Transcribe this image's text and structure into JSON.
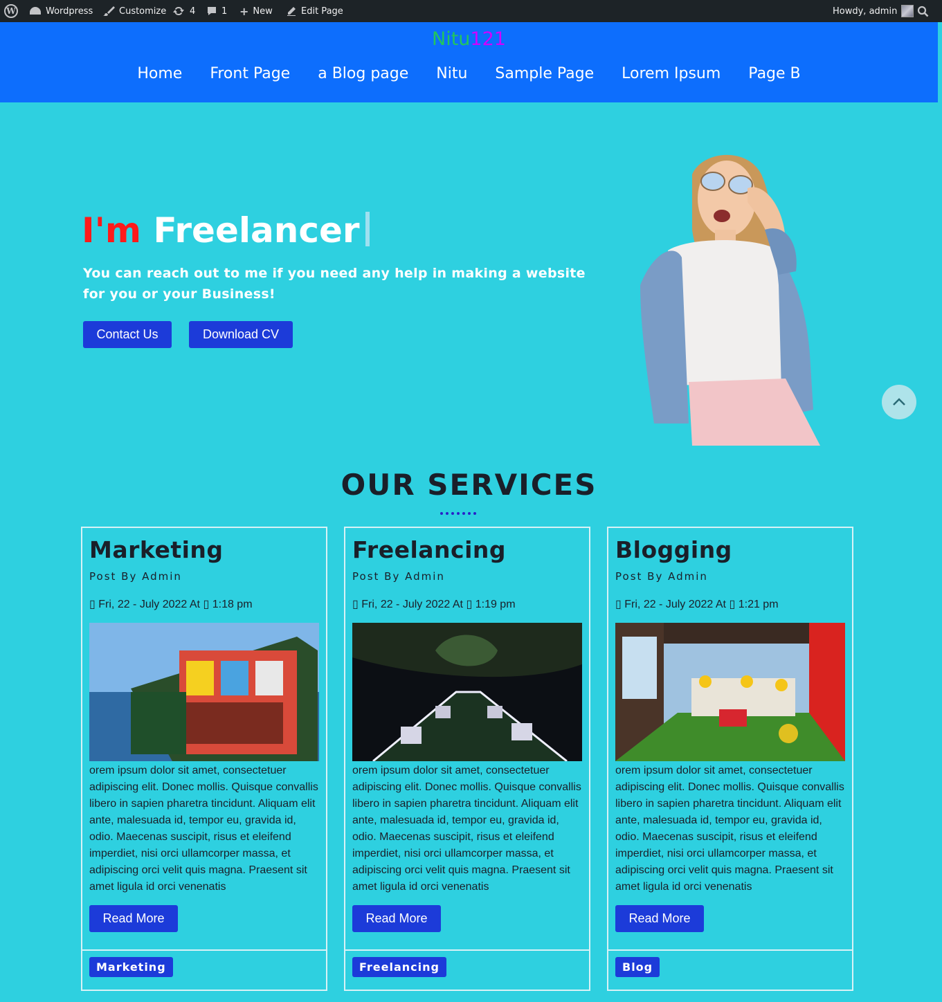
{
  "adminbar": {
    "site_name": "Wordpress",
    "customize": "Customize",
    "updates_count": "4",
    "comments_count": "1",
    "new": "New",
    "edit_page": "Edit Page",
    "howdy": "Howdy, admin"
  },
  "header": {
    "site_title_part1": "Nitu",
    "site_title_part2": "121",
    "nav": [
      "Home",
      "Front Page",
      "a Blog page",
      "Nitu",
      "Sample Page",
      "Lorem Ipsum",
      "Page B"
    ]
  },
  "hero": {
    "title_prefix": "I'm",
    "title_word": "Freelancer",
    "subtitle": "You can reach out to me if you need any help in making a website for you or your Business!",
    "contact_button": "Contact Us",
    "download_button": "Download CV"
  },
  "services": {
    "title": "OUR SERVICES",
    "cards": [
      {
        "title": "Marketing",
        "by": "Post By Admin",
        "date": "Fri, 22 - July 2022 At",
        "time": "1:18 pm",
        "body": "orem ipsum dolor sit amet, consectetuer adipiscing elit. Donec mollis. Quisque convallis libero in sapien pharetra tincidunt. Aliquam elit ante, malesuada id, tempor eu, gravida id, odio. Maecenas suscipit, risus et eleifend imperdiet, nisi orci ullamcorper massa, et adipiscing orci velit quis magna. Praesent sit amet ligula id orci venenatis",
        "read_more": "Read More",
        "tag": "Marketing"
      },
      {
        "title": "Freelancing",
        "by": "Post By Admin",
        "date": "Fri, 22 - July 2022 At",
        "time": "1:19 pm",
        "body": "orem ipsum dolor sit amet, consectetuer adipiscing elit. Donec mollis. Quisque convallis libero in sapien pharetra tincidunt. Aliquam elit ante, malesuada id, tempor eu, gravida id, odio. Maecenas suscipit, risus et eleifend imperdiet, nisi orci ullamcorper massa, et adipiscing orci velit quis magna. Praesent sit amet ligula id orci venenatis",
        "read_more": "Read More",
        "tag": "Freelancing"
      },
      {
        "title": "Blogging",
        "by": "Post By Admin",
        "date": "Fri, 22 - July 2022 At",
        "time": "1:21 pm",
        "body": "orem ipsum dolor sit amet, consectetuer adipiscing elit. Donec mollis. Quisque convallis libero in sapien pharetra tincidunt. Aliquam elit ante, malesuada id, tempor eu, gravida id, odio. Maecenas suscipit, risus et eleifend imperdiet, nisi orci ullamcorper massa, et adipiscing orci velit quis magna. Praesent sit amet ligula id orci venenatis",
        "read_more": "Read More",
        "tag": "Blog"
      }
    ]
  },
  "colors": {
    "page_bg": "#2ed0e0",
    "header_bg": "#0d6efd",
    "button_bg": "#1c3bd9",
    "accent_red": "#ff1a1a"
  }
}
